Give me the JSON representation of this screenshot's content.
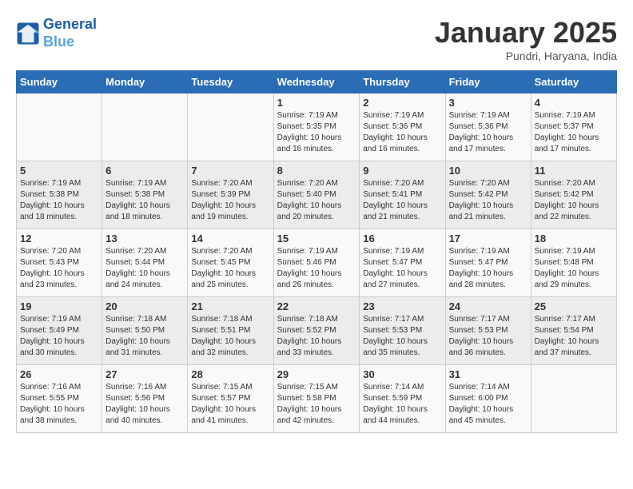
{
  "header": {
    "logo_line1": "General",
    "logo_line2": "Blue",
    "month_title": "January 2025",
    "subtitle": "Pundri, Haryana, India"
  },
  "weekdays": [
    "Sunday",
    "Monday",
    "Tuesday",
    "Wednesday",
    "Thursday",
    "Friday",
    "Saturday"
  ],
  "weeks": [
    [
      {
        "day": "",
        "info": ""
      },
      {
        "day": "",
        "info": ""
      },
      {
        "day": "",
        "info": ""
      },
      {
        "day": "1",
        "info": "Sunrise: 7:19 AM\nSunset: 5:35 PM\nDaylight: 10 hours\nand 16 minutes."
      },
      {
        "day": "2",
        "info": "Sunrise: 7:19 AM\nSunset: 5:36 PM\nDaylight: 10 hours\nand 16 minutes."
      },
      {
        "day": "3",
        "info": "Sunrise: 7:19 AM\nSunset: 5:36 PM\nDaylight: 10 hours\nand 17 minutes."
      },
      {
        "day": "4",
        "info": "Sunrise: 7:19 AM\nSunset: 5:37 PM\nDaylight: 10 hours\nand 17 minutes."
      }
    ],
    [
      {
        "day": "5",
        "info": "Sunrise: 7:19 AM\nSunset: 5:38 PM\nDaylight: 10 hours\nand 18 minutes."
      },
      {
        "day": "6",
        "info": "Sunrise: 7:19 AM\nSunset: 5:38 PM\nDaylight: 10 hours\nand 18 minutes."
      },
      {
        "day": "7",
        "info": "Sunrise: 7:20 AM\nSunset: 5:39 PM\nDaylight: 10 hours\nand 19 minutes."
      },
      {
        "day": "8",
        "info": "Sunrise: 7:20 AM\nSunset: 5:40 PM\nDaylight: 10 hours\nand 20 minutes."
      },
      {
        "day": "9",
        "info": "Sunrise: 7:20 AM\nSunset: 5:41 PM\nDaylight: 10 hours\nand 21 minutes."
      },
      {
        "day": "10",
        "info": "Sunrise: 7:20 AM\nSunset: 5:42 PM\nDaylight: 10 hours\nand 21 minutes."
      },
      {
        "day": "11",
        "info": "Sunrise: 7:20 AM\nSunset: 5:42 PM\nDaylight: 10 hours\nand 22 minutes."
      }
    ],
    [
      {
        "day": "12",
        "info": "Sunrise: 7:20 AM\nSunset: 5:43 PM\nDaylight: 10 hours\nand 23 minutes."
      },
      {
        "day": "13",
        "info": "Sunrise: 7:20 AM\nSunset: 5:44 PM\nDaylight: 10 hours\nand 24 minutes."
      },
      {
        "day": "14",
        "info": "Sunrise: 7:20 AM\nSunset: 5:45 PM\nDaylight: 10 hours\nand 25 minutes."
      },
      {
        "day": "15",
        "info": "Sunrise: 7:19 AM\nSunset: 5:46 PM\nDaylight: 10 hours\nand 26 minutes."
      },
      {
        "day": "16",
        "info": "Sunrise: 7:19 AM\nSunset: 5:47 PM\nDaylight: 10 hours\nand 27 minutes."
      },
      {
        "day": "17",
        "info": "Sunrise: 7:19 AM\nSunset: 5:47 PM\nDaylight: 10 hours\nand 28 minutes."
      },
      {
        "day": "18",
        "info": "Sunrise: 7:19 AM\nSunset: 5:48 PM\nDaylight: 10 hours\nand 29 minutes."
      }
    ],
    [
      {
        "day": "19",
        "info": "Sunrise: 7:19 AM\nSunset: 5:49 PM\nDaylight: 10 hours\nand 30 minutes."
      },
      {
        "day": "20",
        "info": "Sunrise: 7:18 AM\nSunset: 5:50 PM\nDaylight: 10 hours\nand 31 minutes."
      },
      {
        "day": "21",
        "info": "Sunrise: 7:18 AM\nSunset: 5:51 PM\nDaylight: 10 hours\nand 32 minutes."
      },
      {
        "day": "22",
        "info": "Sunrise: 7:18 AM\nSunset: 5:52 PM\nDaylight: 10 hours\nand 33 minutes."
      },
      {
        "day": "23",
        "info": "Sunrise: 7:17 AM\nSunset: 5:53 PM\nDaylight: 10 hours\nand 35 minutes."
      },
      {
        "day": "24",
        "info": "Sunrise: 7:17 AM\nSunset: 5:53 PM\nDaylight: 10 hours\nand 36 minutes."
      },
      {
        "day": "25",
        "info": "Sunrise: 7:17 AM\nSunset: 5:54 PM\nDaylight: 10 hours\nand 37 minutes."
      }
    ],
    [
      {
        "day": "26",
        "info": "Sunrise: 7:16 AM\nSunset: 5:55 PM\nDaylight: 10 hours\nand 38 minutes."
      },
      {
        "day": "27",
        "info": "Sunrise: 7:16 AM\nSunset: 5:56 PM\nDaylight: 10 hours\nand 40 minutes."
      },
      {
        "day": "28",
        "info": "Sunrise: 7:15 AM\nSunset: 5:57 PM\nDaylight: 10 hours\nand 41 minutes."
      },
      {
        "day": "29",
        "info": "Sunrise: 7:15 AM\nSunset: 5:58 PM\nDaylight: 10 hours\nand 42 minutes."
      },
      {
        "day": "30",
        "info": "Sunrise: 7:14 AM\nSunset: 5:59 PM\nDaylight: 10 hours\nand 44 minutes."
      },
      {
        "day": "31",
        "info": "Sunrise: 7:14 AM\nSunset: 6:00 PM\nDaylight: 10 hours\nand 45 minutes."
      },
      {
        "day": "",
        "info": ""
      }
    ]
  ]
}
